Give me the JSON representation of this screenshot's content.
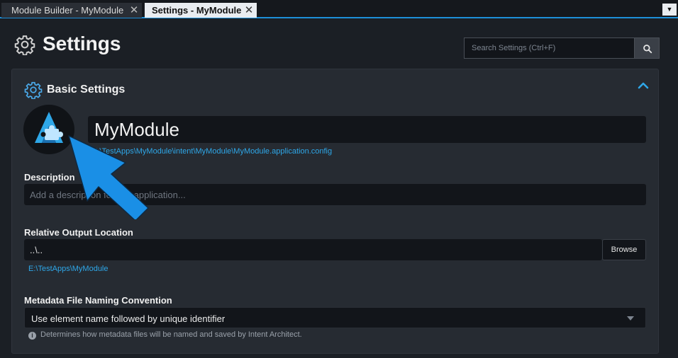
{
  "tabs": [
    {
      "label": "Module Builder - MyModule",
      "active": false
    },
    {
      "label": "Settings - MyModule",
      "active": true
    }
  ],
  "header": {
    "title": "Settings",
    "search_placeholder": "Search Settings (Ctrl+F)"
  },
  "section": {
    "title": "Basic Settings",
    "app_name": "MyModule",
    "config_path": "E:\\TestApps\\MyModule\\intent\\MyModule\\MyModule.application.config"
  },
  "description": {
    "label": "Description",
    "placeholder": "Add a description for this application..."
  },
  "output": {
    "label": "Relative Output Location",
    "value": "..\\..",
    "browse_label": "Browse",
    "resolved_path": "E:\\TestApps\\MyModule"
  },
  "metadata": {
    "label": "Metadata File Naming Convention",
    "selected": "Use element name followed by unique identifier",
    "hint": "Determines how metadata files will be named and saved by Intent Architect."
  },
  "colors": {
    "accent": "#1d8fd8",
    "link": "#2ea7e8",
    "arrow": "#1a8fe6"
  },
  "icons": [
    "close-icon",
    "dropdown-icon",
    "gear-icon",
    "search-icon",
    "chevron-up-icon",
    "app-logo",
    "info-icon",
    "annotation-arrow"
  ]
}
